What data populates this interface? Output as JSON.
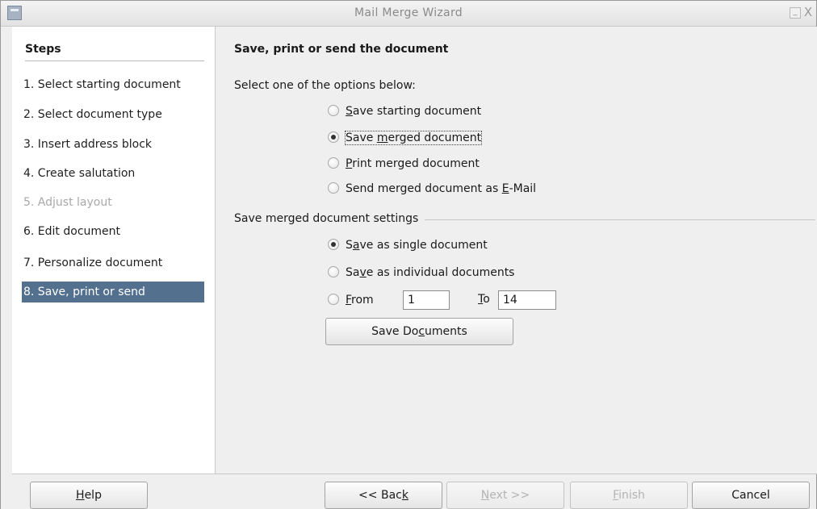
{
  "window": {
    "title": "Mail Merge Wizard",
    "minimize_glyph": "_",
    "close_glyph": "X"
  },
  "steps": {
    "heading": "Steps",
    "items": [
      {
        "label": "1. Select starting document",
        "state": "normal"
      },
      {
        "label": "2. Select document type",
        "state": "normal"
      },
      {
        "label": "3. Insert address block",
        "state": "normal"
      },
      {
        "label": "4. Create salutation",
        "state": "normal"
      },
      {
        "label": "5. Adjust layout",
        "state": "disabled"
      },
      {
        "label": "6. Edit document",
        "state": "normal"
      },
      {
        "label": "7. Personalize document",
        "state": "normal"
      },
      {
        "label": "8. Save, print or send",
        "state": "active"
      }
    ]
  },
  "main": {
    "title": "Save, print or send the document",
    "instruction": "Select one of the options below:",
    "options": {
      "save_starting": {
        "label_pre": "",
        "label_key": "S",
        "label_post": "ave starting document",
        "checked": false
      },
      "save_merged": {
        "label_pre": "Save ",
        "label_key": "m",
        "label_post": "erged document",
        "checked": true
      },
      "print_merged": {
        "label_pre": "",
        "label_key": "P",
        "label_post": "rint merged document",
        "checked": false
      },
      "send_email": {
        "label_pre": "Send merged document as ",
        "label_key": "E",
        "label_post": "-Mail",
        "checked": false
      }
    },
    "settings": {
      "label": "Save merged document settings",
      "single": {
        "label_pre": "S",
        "label_key": "a",
        "label_post": "ve as single document",
        "checked": true
      },
      "individual": {
        "label_pre": "Sa",
        "label_key": "v",
        "label_post": "e as individual documents",
        "checked": false
      },
      "from": {
        "label_pre": "",
        "label_key": "F",
        "label_post": "rom",
        "checked": false,
        "value": "1"
      },
      "to": {
        "label_pre": "",
        "label_key": "T",
        "label_post": "o",
        "value": "14"
      },
      "save_documents_button": {
        "label_pre": "Save Do",
        "label_key": "c",
        "label_post": "uments"
      }
    }
  },
  "buttons": {
    "help": {
      "label_pre": "",
      "label_key": "H",
      "label_post": "elp"
    },
    "back": {
      "label_pre": "<< Bac",
      "label_key": "k",
      "label_post": ""
    },
    "next": {
      "label_pre": "",
      "label_key": "N",
      "label_post": "ext >>",
      "enabled": false
    },
    "finish": {
      "label_pre": "",
      "label_key": "F",
      "label_post": "inish",
      "enabled": false
    },
    "cancel": {
      "label": "Cancel"
    }
  },
  "colors": {
    "active_step_bg": "#54708f",
    "disabled_text": "#a9a9a9"
  }
}
